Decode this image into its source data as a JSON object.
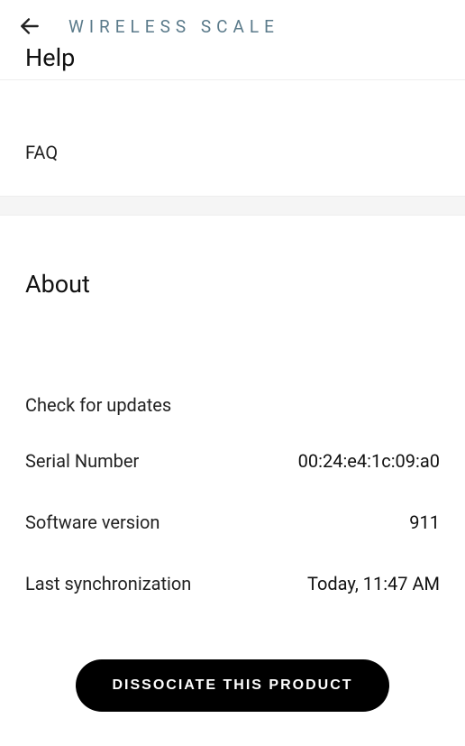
{
  "header": {
    "title": "WIRELESS SCALE"
  },
  "help": {
    "title": "Help",
    "faq_label": "FAQ"
  },
  "about": {
    "title": "About",
    "check_updates_label": "Check for updates",
    "serial_label": "Serial Number",
    "serial_value": "00:24:e4:1c:09:a0",
    "software_label": "Software version",
    "software_value": "911",
    "lastsync_label": "Last synchronization",
    "lastsync_value": "Today, 11:47 AM"
  },
  "footer": {
    "dissociate_label": "DISSOCIATE THIS PRODUCT"
  }
}
